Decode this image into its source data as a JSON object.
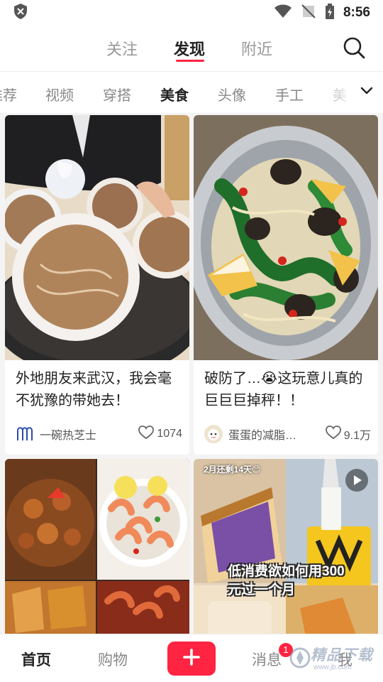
{
  "status_bar": {
    "time": "8:56"
  },
  "top_nav": {
    "tabs": [
      {
        "label": "关注"
      },
      {
        "label": "发现"
      },
      {
        "label": "附近"
      }
    ],
    "active_tab": "发现"
  },
  "categories": {
    "items": [
      "推荐",
      "视频",
      "穿搭",
      "美食",
      "头像",
      "手工",
      "美"
    ],
    "active": "美食"
  },
  "feed": {
    "cards": [
      {
        "title": "外地朋友来武汉，我会毫不犹豫的带她去！",
        "author": "一碗热芝士",
        "likes": "1074"
      },
      {
        "title": "破防了…😭这玩意儿真的巨巨巨掉秤！！",
        "author": "蛋蛋的减脂…",
        "likes": "9.1万"
      },
      {
        "overlay_tag": "2月还剩14天😊",
        "overlay_main": "低消费欲如何用300元过一个月"
      }
    ]
  },
  "bottom_nav": {
    "items": [
      {
        "label": "首页"
      },
      {
        "label": "购物"
      },
      {
        "label": "消息"
      },
      {
        "label": "我"
      }
    ],
    "active": "首页",
    "message_badge": "1"
  },
  "watermark": {
    "text": "精品下载",
    "sub": "www.jb.com"
  },
  "colors": {
    "accent": "#ff2442",
    "text_primary": "#222222",
    "text_secondary": "#888888"
  }
}
